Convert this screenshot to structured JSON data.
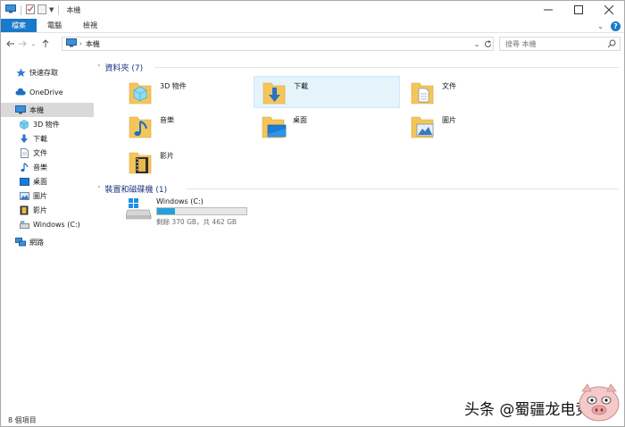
{
  "window": {
    "title": "本機"
  },
  "ribbon": {
    "tabs": [
      {
        "label": "檔案",
        "active": true
      },
      {
        "label": "電腦",
        "active": false
      },
      {
        "label": "檢視",
        "active": false
      }
    ]
  },
  "address": {
    "path": "本機",
    "search_placeholder": "搜尋 本機"
  },
  "sidebar": {
    "items": [
      {
        "label": "快速存取",
        "icon": "star-icon"
      },
      {
        "label": "OneDrive",
        "icon": "cloud-icon"
      },
      {
        "label": "本機",
        "icon": "monitor-icon",
        "selected": true
      },
      {
        "label": "3D 物件",
        "icon": "cube-icon"
      },
      {
        "label": "下載",
        "icon": "download-icon"
      },
      {
        "label": "文件",
        "icon": "document-icon"
      },
      {
        "label": "音樂",
        "icon": "music-icon"
      },
      {
        "label": "桌面",
        "icon": "desktop-icon"
      },
      {
        "label": "圖片",
        "icon": "picture-icon"
      },
      {
        "label": "影片",
        "icon": "video-icon"
      },
      {
        "label": "Windows (C:)",
        "icon": "drive-icon"
      },
      {
        "label": "網路",
        "icon": "network-icon"
      }
    ]
  },
  "folders_group": {
    "header": "資料夾 (7)",
    "items": [
      {
        "label": "3D 物件",
        "icon": "cube-folder-icon"
      },
      {
        "label": "下載",
        "icon": "download-folder-icon"
      },
      {
        "label": "文件",
        "icon": "document-folder-icon"
      },
      {
        "label": "音樂",
        "icon": "music-folder-icon"
      },
      {
        "label": "桌面",
        "icon": "desktop-folder-icon"
      },
      {
        "label": "圖片",
        "icon": "picture-folder-icon"
      },
      {
        "label": "影片",
        "icon": "video-folder-icon"
      }
    ]
  },
  "devices_group": {
    "header": "裝置和磁碟機 (1)",
    "drive": {
      "name": "Windows (C:)",
      "space": "剩餘 370 GB，共 462 GB",
      "used_fraction": 0.2
    }
  },
  "status": {
    "items_count": "8 個項目"
  },
  "watermark": {
    "text": "头条 @蜀疆龙电竞馆"
  },
  "colors": {
    "accent": "#1979ca",
    "folder": "#f4c55a",
    "group_header": "#1e3287",
    "drive_fill": "#26a0da"
  }
}
